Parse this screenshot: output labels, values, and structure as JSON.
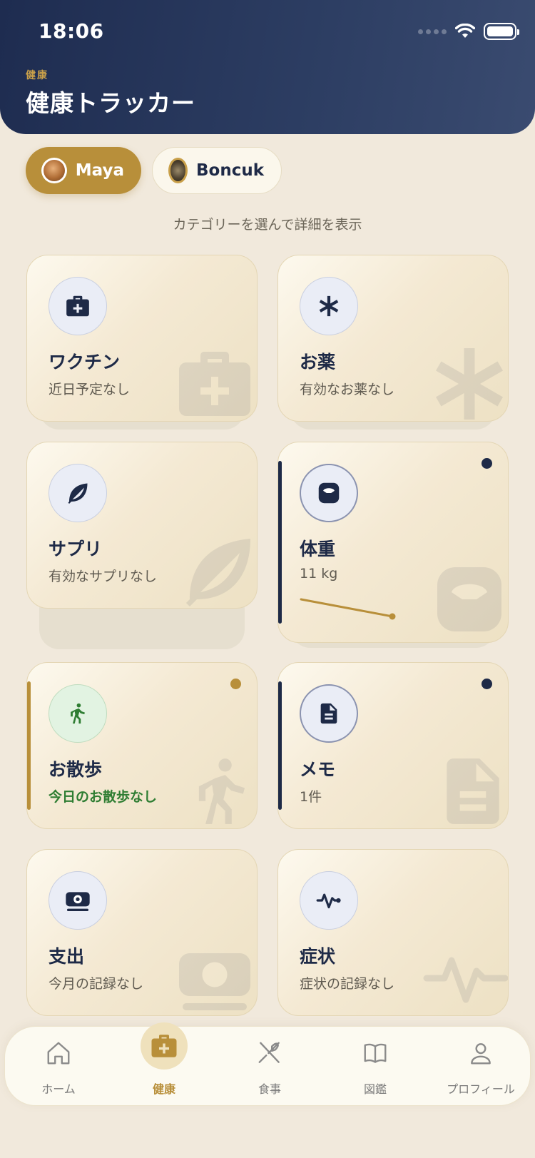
{
  "status_bar": {
    "time": "18:06"
  },
  "header": {
    "eyebrow": "健康",
    "title": "健康トラッカー"
  },
  "pets": [
    {
      "name": "Maya",
      "selected": true
    },
    {
      "name": "Boncuk",
      "selected": false
    }
  ],
  "subtitle": "カテゴリーを選んで詳細を表示",
  "categories": [
    {
      "key": "vaccine",
      "title": "ワクチン",
      "subtitle": "近日予定なし",
      "icon": "medkit-icon"
    },
    {
      "key": "medicine",
      "title": "お薬",
      "subtitle": "有効なお薬なし",
      "icon": "asterisk-icon"
    },
    {
      "key": "supplement",
      "title": "サプリ",
      "subtitle": "有効なサプリなし",
      "icon": "leaf-icon"
    },
    {
      "key": "weight",
      "title": "体重",
      "subtitle": "11 kg",
      "icon": "scale-icon",
      "accent": "#1e2a47",
      "has_indicator": true
    },
    {
      "key": "walk",
      "title": "お散歩",
      "subtitle": "今日のお散歩なし",
      "icon": "walking-icon",
      "accent": "#b88f3a",
      "has_indicator": true
    },
    {
      "key": "memo",
      "title": "メモ",
      "subtitle": "1件",
      "icon": "document-icon",
      "accent": "#1e2a47",
      "has_indicator": true
    },
    {
      "key": "expense",
      "title": "支出",
      "subtitle": "今月の記録なし",
      "icon": "money-icon"
    },
    {
      "key": "symptom",
      "title": "症状",
      "subtitle": "症状の記録なし",
      "icon": "pulse-icon"
    }
  ],
  "nav": [
    {
      "label": "ホーム",
      "icon": "home-icon",
      "active": false
    },
    {
      "label": "健康",
      "icon": "medkit-icon",
      "active": true
    },
    {
      "label": "食事",
      "icon": "utensils-icon",
      "active": false
    },
    {
      "label": "図鑑",
      "icon": "book-icon",
      "active": false
    },
    {
      "label": "プロフィール",
      "icon": "user-icon",
      "active": false
    }
  ],
  "colors": {
    "navy": "#1e2a47",
    "gold": "#b88f3a",
    "green": "#2e7d32",
    "background": "#f1e9dc"
  }
}
